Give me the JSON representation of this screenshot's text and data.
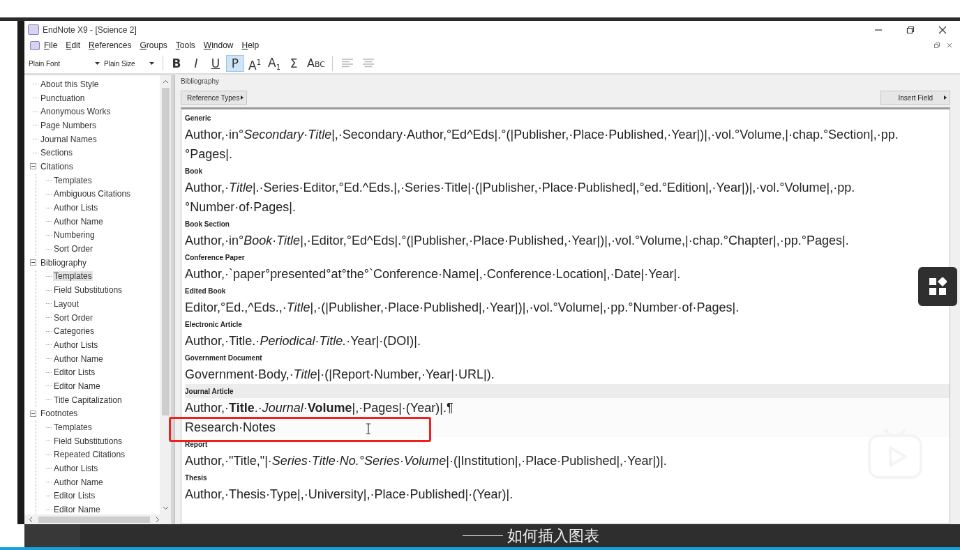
{
  "window": {
    "title": "EndNote X9 - [Science 2]"
  },
  "menu": [
    "File",
    "Edit",
    "References",
    "Groups",
    "Tools",
    "Window",
    "Help"
  ],
  "toolbar": {
    "font": "Plain Font",
    "size": "Plain Size",
    "format_buttons": [
      {
        "label": "B",
        "kind": "bold",
        "selected": false
      },
      {
        "label": "I",
        "kind": "italic",
        "selected": false
      },
      {
        "label": "U",
        "kind": "underline",
        "selected": false
      },
      {
        "label": "P",
        "kind": "plain",
        "selected": true
      },
      {
        "label": "A$^{1}$",
        "kind": "script",
        "selected": false
      },
      {
        "label": "A$_{1}$",
        "kind": "script",
        "selected": false
      },
      {
        "label": "Σ",
        "kind": "symbol",
        "selected": false
      },
      {
        "label": "Abc",
        "kind": "smallcaps",
        "selected": false
      }
    ]
  },
  "tree": [
    {
      "label": "About this Style",
      "selected": false
    },
    {
      "label": "Punctuation",
      "selected": false
    },
    {
      "label": "Anonymous Works",
      "selected": false
    },
    {
      "label": "Page Numbers",
      "selected": false
    },
    {
      "label": "Journal Names",
      "selected": false
    },
    {
      "label": "Sections",
      "selected": false
    },
    {
      "label": "Citations",
      "selected": false,
      "expanded": true,
      "children": [
        {
          "label": "Templates",
          "selected": false
        },
        {
          "label": "Ambiguous Citations",
          "selected": false
        },
        {
          "label": "Author Lists",
          "selected": false
        },
        {
          "label": "Author Name",
          "selected": false
        },
        {
          "label": "Numbering",
          "selected": false
        },
        {
          "label": "Sort Order",
          "selected": false
        }
      ]
    },
    {
      "label": "Bibliography",
      "selected": false,
      "expanded": true,
      "children": [
        {
          "label": "Templates",
          "selected": true
        },
        {
          "label": "Field Substitutions",
          "selected": false
        },
        {
          "label": "Layout",
          "selected": false
        },
        {
          "label": "Sort Order",
          "selected": false
        },
        {
          "label": "Categories",
          "selected": false
        },
        {
          "label": "Author Lists",
          "selected": false
        },
        {
          "label": "Author Name",
          "selected": false
        },
        {
          "label": "Editor Lists",
          "selected": false
        },
        {
          "label": "Editor Name",
          "selected": false
        },
        {
          "label": "Title Capitalization",
          "selected": false
        }
      ]
    },
    {
      "label": "Footnotes",
      "selected": false,
      "expanded": true,
      "children": [
        {
          "label": "Templates",
          "selected": false
        },
        {
          "label": "Field Substitutions",
          "selected": false
        },
        {
          "label": "Repeated Citations",
          "selected": false
        },
        {
          "label": "Author Lists",
          "selected": false
        },
        {
          "label": "Author Name",
          "selected": false
        },
        {
          "label": "Editor Lists",
          "selected": false
        },
        {
          "label": "Editor Name",
          "selected": false
        }
      ]
    }
  ],
  "panel": {
    "title": "Bibliography",
    "reference_types_button": "Reference Types",
    "insert_field_button": "Insert Field"
  },
  "templates": [
    {
      "type": "Generic",
      "selected": false,
      "lines": [
        "Author,·in°*Secondary·Title*|,·Secondary·Author,°Ed^Eds|.°(|Publisher,·Place·Published,·Year|)|,·vol.°Volume,|·chap.°Section|,·pp.°Pages|."
      ]
    },
    {
      "type": "Book",
      "selected": false,
      "lines": [
        "Author,·*Title*|.·Series·Editor,°Ed.^Eds.|,·Series·Title|·(|Publisher,·Place·Published|,°ed.°Edition|,·Year|)|,·vol.°Volume|,·pp.°Number·of·Pages|."
      ]
    },
    {
      "type": "Book Section",
      "selected": false,
      "lines": [
        "Author,·in°*Book·Title*|,·Editor,°Ed^Eds|.°(|Publisher,·Place·Published,·Year|)|,·vol.°Volume,|·chap.°Chapter|,·pp.°Pages|."
      ]
    },
    {
      "type": "Conference Paper",
      "selected": false,
      "lines": [
        "Author,·`paper°presented°at°the°`Conference·Name|,·Conference·Location|,·Date|·Year|."
      ]
    },
    {
      "type": "Edited Book",
      "selected": false,
      "lines": [
        "Editor,°Ed.,^Eds.,·*Title*|,·(|Publisher,·Place·Published|,·Year|)|,·vol.°Volume|,·pp.°Number·of·Pages|."
      ]
    },
    {
      "type": "Electronic Article",
      "selected": false,
      "lines": [
        "Author,·Title.·*Periodical·Title.*·Year|·(DOI)|."
      ]
    },
    {
      "type": "Government Document",
      "selected": false,
      "lines": [
        "Government·Body,·*Title*|·(|Report·Number,·Year|·URL|)."
      ]
    },
    {
      "type": "Journal Article",
      "selected": true,
      "lines": [
        "Author,·**Title**.·*Journal*·**Volume**|,·Pages|·(Year)|.¶",
        "Research·Notes"
      ]
    },
    {
      "type": "Report",
      "selected": false,
      "lines": [
        "Author,·\"Title,\"|·*Series·Title·No.°Series·Volume*|·(|Institution|,·Place·Published|,·Year|)|."
      ]
    },
    {
      "type": "Thesis",
      "selected": false,
      "lines": [
        "Author,·Thesis·Type|,·University|,·Place·Published|·(Year)|."
      ]
    }
  ],
  "subtitle": "如何插入图表",
  "progress": {
    "level": 1
  }
}
